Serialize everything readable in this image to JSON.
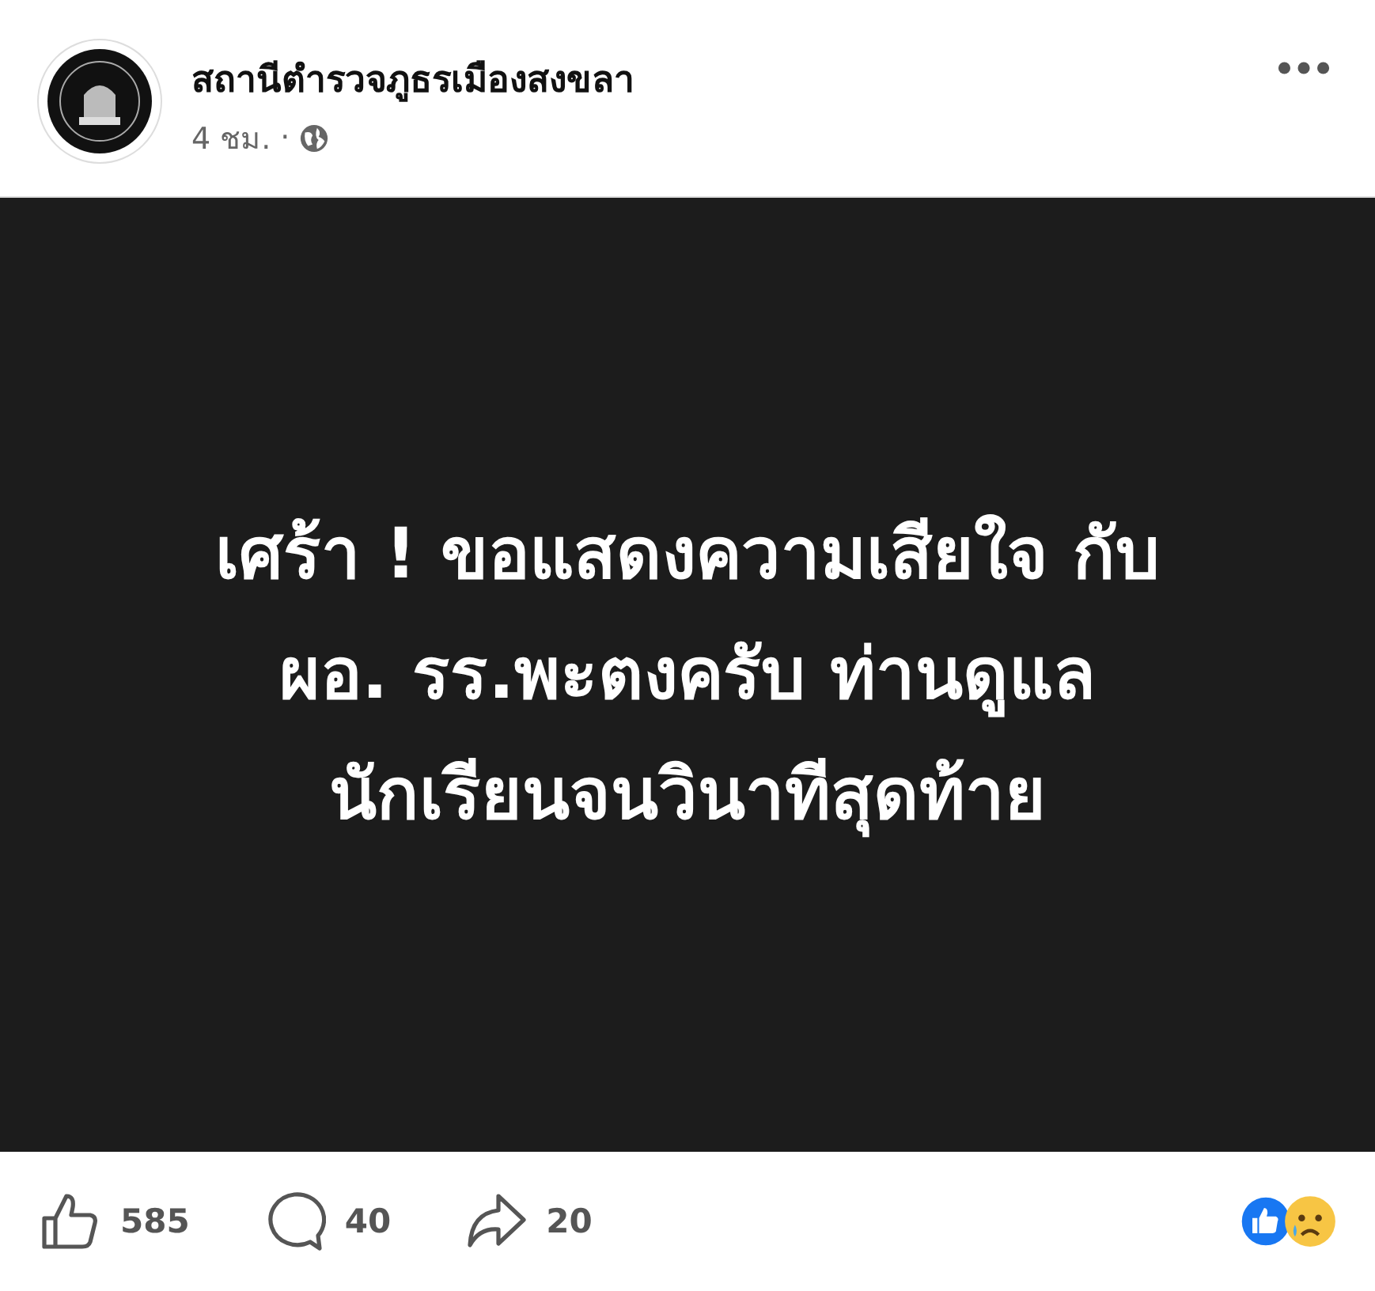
{
  "post": {
    "author": "สถานีตำรวจภูธรเมืองสงขลา",
    "time": "4 ชม.",
    "separator": "·",
    "image_text": [
      "เศร้า ! ขอแสดงความเสียใจ กับ",
      "ผอ. รร.พะตงครับ ท่านดูแล",
      "นักเรียนจนวินาทีสุดท้าย"
    ],
    "actions": [
      {
        "kind": "like",
        "count": "585"
      },
      {
        "kind": "comment",
        "count": "40"
      },
      {
        "kind": "share",
        "count": "20"
      }
    ],
    "reactions": [
      {
        "kind": "like"
      },
      {
        "kind": "sad"
      }
    ]
  }
}
